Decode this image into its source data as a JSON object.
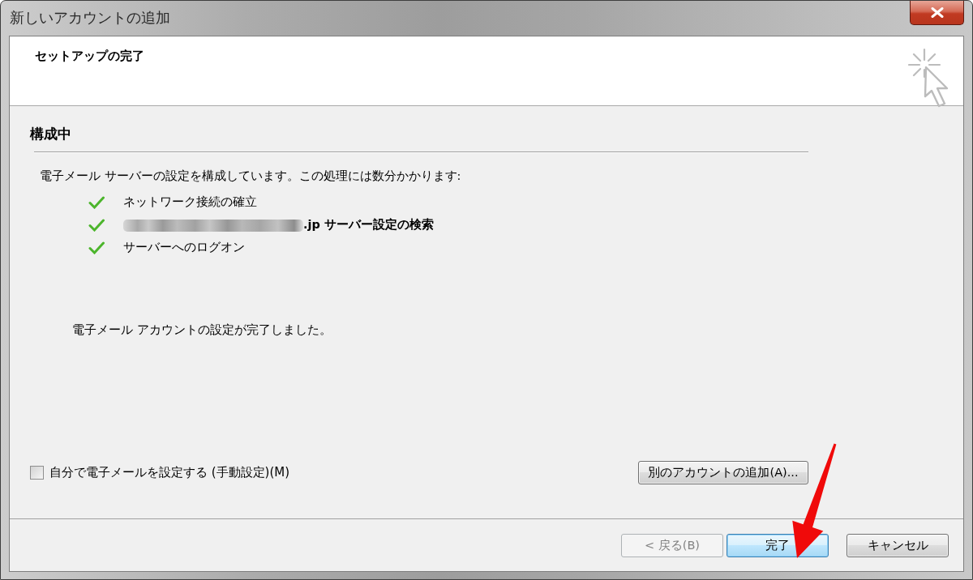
{
  "window": {
    "title": "新しいアカウントの追加"
  },
  "header": {
    "title": "セットアップの完了"
  },
  "section": {
    "title": "構成中",
    "description": "電子メール サーバーの設定を構成しています。この処理には数分かかります:",
    "steps": [
      {
        "label": "ネットワーク接続の確立",
        "done": true,
        "current": false,
        "redacted_prefix": false
      },
      {
        "label": ".jp サーバー設定の検索",
        "done": true,
        "current": true,
        "redacted_prefix": true
      },
      {
        "label": "サーバーへのログオン",
        "done": true,
        "current": false,
        "redacted_prefix": false
      }
    ],
    "result": "電子メール アカウントの設定が完了しました。"
  },
  "manual_setup": {
    "label": "自分で電子メールを設定する (手動設定)(M)",
    "checked": false
  },
  "add_account_button": "別のアカウントの追加(A)...",
  "buttons": [
    {
      "label": "< 戻る(B)",
      "disabled": true,
      "default": false
    },
    {
      "label": "完了",
      "disabled": false,
      "default": true
    },
    {
      "label": "キャンセル",
      "disabled": false,
      "default": false
    }
  ]
}
